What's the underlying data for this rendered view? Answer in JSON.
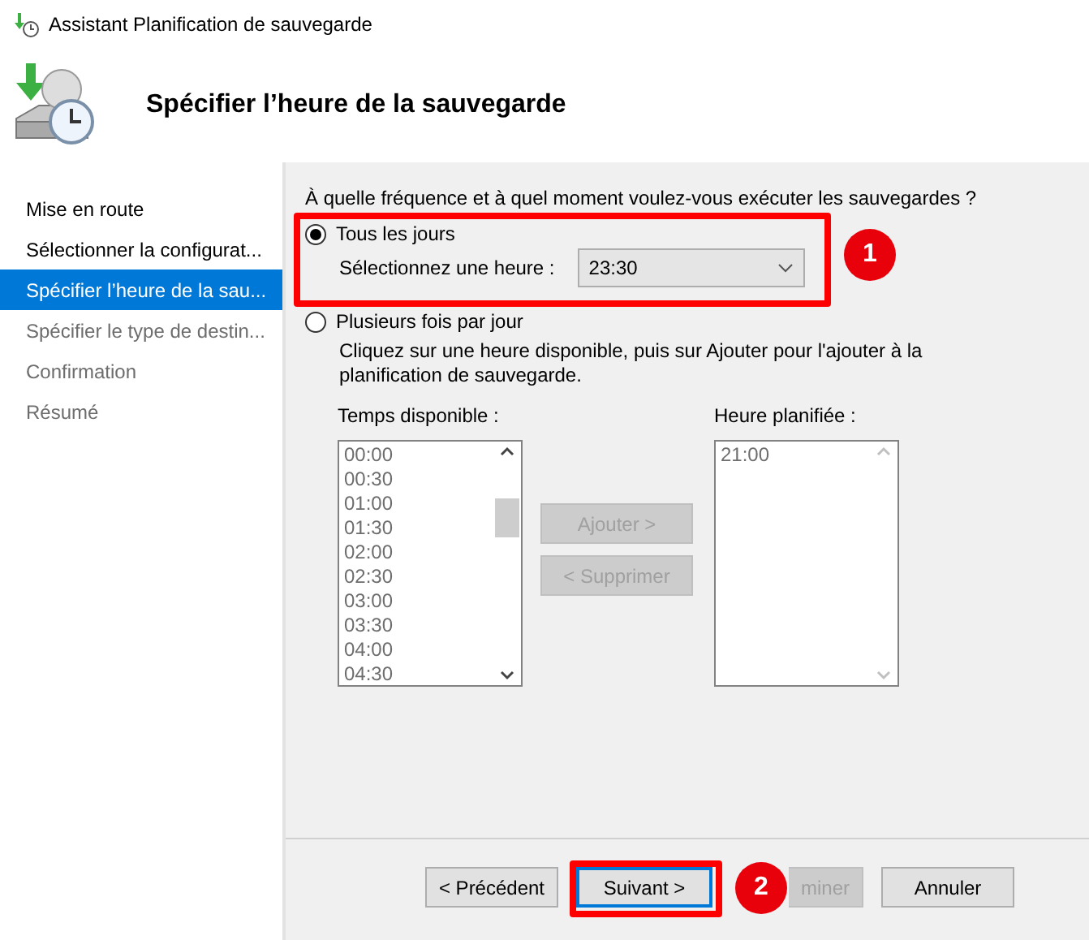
{
  "window": {
    "title": "Assistant Planification de sauvegarde"
  },
  "header": {
    "title": "Spécifier l’heure de la sauvegarde"
  },
  "sidebar": {
    "items": [
      {
        "label": "Mise en route",
        "selected": false,
        "disabled": false
      },
      {
        "label": "Sélectionner la configurat...",
        "selected": false,
        "disabled": false
      },
      {
        "label": "Spécifier l’heure de la sau...",
        "selected": true,
        "disabled": false
      },
      {
        "label": "Spécifier le type de destin...",
        "selected": false,
        "disabled": true
      },
      {
        "label": "Confirmation",
        "selected": false,
        "disabled": true
      },
      {
        "label": "Résumé",
        "selected": false,
        "disabled": true
      }
    ]
  },
  "question": "À quelle fréquence et à quel moment voulez-vous exécuter les sauvegardes ?",
  "options": [
    {
      "kind": "daily",
      "label": "Tous les jours",
      "selected": true,
      "time_label": "Sélectionnez une heure :",
      "time_value": "23:30"
    },
    {
      "kind": "multiple",
      "label": "Plusieurs fois par jour",
      "selected": false,
      "description": "Cliquez sur une heure disponible, puis sur Ajouter pour l'ajouter à la planification de sauvegarde."
    }
  ],
  "available": {
    "label": "Temps disponible :",
    "items": [
      "00:00",
      "00:30",
      "01:00",
      "01:30",
      "02:00",
      "02:30",
      "03:00",
      "03:30",
      "04:00",
      "04:30"
    ]
  },
  "move_buttons": [
    {
      "label": "Ajouter >",
      "disabled": true
    },
    {
      "label": "< Supprimer",
      "disabled": true
    }
  ],
  "scheduled": {
    "label": "Heure planifiée :",
    "items": [
      "21:00"
    ]
  },
  "footer_buttons": [
    {
      "label": "< Précédent",
      "disabled": false,
      "default": false
    },
    {
      "label": "Suivant >",
      "disabled": false,
      "default": true
    },
    {
      "label": "miner",
      "disabled": true,
      "default": false
    },
    {
      "label": "Annuler",
      "disabled": false,
      "default": false
    }
  ],
  "annotations": [
    {
      "number": "1"
    },
    {
      "number": "2"
    }
  ]
}
